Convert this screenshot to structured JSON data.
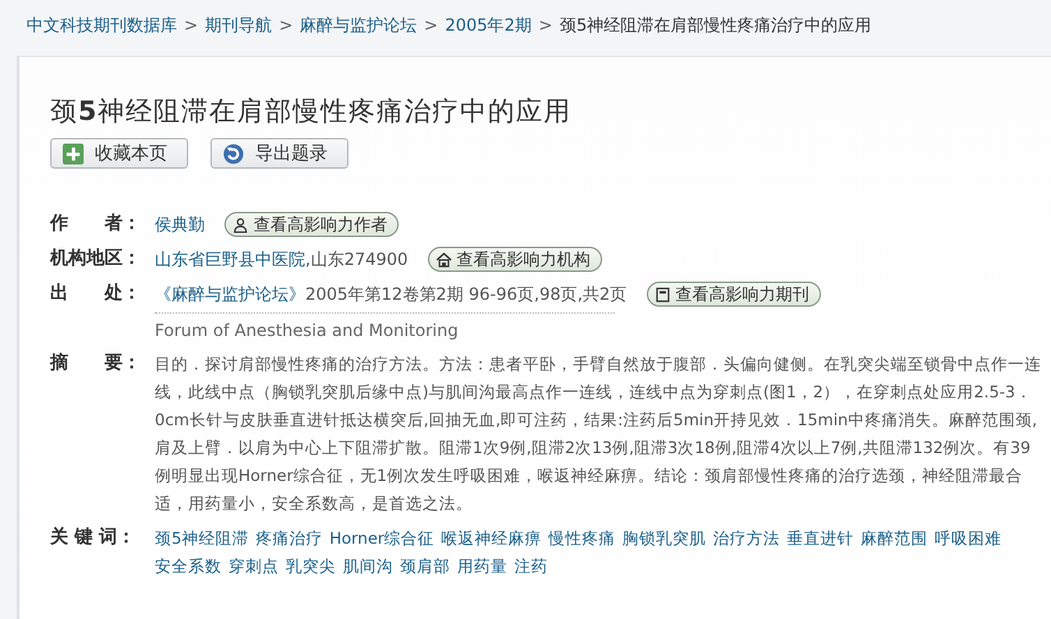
{
  "breadcrumb": [
    {
      "label": "中文科技期刊数据库",
      "kind": "link"
    },
    {
      "label": ">",
      "kind": "separator"
    },
    {
      "label": "期刊导航",
      "kind": "link"
    },
    {
      "label": ">",
      "kind": "separator"
    },
    {
      "label": "麻醉与监护论坛",
      "kind": "link"
    },
    {
      "label": ">",
      "kind": "separator"
    },
    {
      "label": "2005年2期",
      "kind": "link"
    },
    {
      "label": ">",
      "kind": "separator"
    },
    {
      "label": "颈5神经阻滞在肩部慢性疼痛治疗中的应用",
      "kind": "current"
    }
  ],
  "title": "颈**5**神经阻滞在肩部慢性疼痛治疗中的应用",
  "buttons": [
    {
      "label": "收藏本页",
      "kind": "bookmark"
    },
    {
      "label": "导出题录",
      "kind": "export"
    }
  ],
  "meta": [
    {
      "label": "作　　者：",
      "value": "侯典勤",
      "badge": {
        "label": "查看高影响力作者",
        "kind": "author"
      }
    },
    {
      "label": "机构地区：",
      "value": "山东省巨野县中医院",
      "extra": ",山东274900",
      "badge": {
        "label": "查看高影响力机构",
        "kind": "institution"
      }
    },
    {
      "label": "出　　处：",
      "value": "《麻醉与监护论坛》",
      "extra": "2005年第12卷第2期 96-96页,98页,共2页",
      "badge": {
        "label": "查看高影响力期刊",
        "kind": "journal"
      },
      "subtitle": "Forum of Anesthesia and Monitoring"
    }
  ],
  "abstract": {
    "label": "摘　　要：",
    "text": "目的．探讨肩部慢性疼痛的治疗方法。方法：患者平卧，手臂自然放于腹部．头偏向健侧。在乳突尖端至锁骨中点作一连线，此线中点（胸锁乳突肌后缘中点)与肌间沟最高点作一连线，连线中点为穿刺点(图1，2），在穿刺点处应用2.5-3．0cm长针与皮肤垂直进针抵达横突后,回抽无血,即可注药，结果:注药后5min开持见效．15min中疼痛消失。麻醉范围颈,肩及上臂．以肩为中心上下阻滞扩散。阻滞1次9例,阻滞2次13例,阻滞3次18例,阻滞4次以上7例,共阻滞132例次。有39例明显出现Horner综合征，无1例次发生呼吸困难，喉返神经麻痹。结论：颈肩部慢性疼痛的治疗选颈，神经阻滞最合适，用药量小，安全系数高，是首选之法。"
  },
  "keywords": {
    "label": "关 键 词：",
    "items": [
      "颈5神经阻滞",
      "疼痛治疗",
      "Horner综合征",
      "喉返神经麻痹",
      "慢性疼痛",
      "胸锁乳突肌",
      "治疗方法",
      "垂直进针",
      "麻醉范围",
      "呼吸困难",
      "安全系数",
      "穿刺点",
      "乳突尖",
      "肌间沟",
      "颈肩部",
      "用药量",
      "注药"
    ]
  }
}
